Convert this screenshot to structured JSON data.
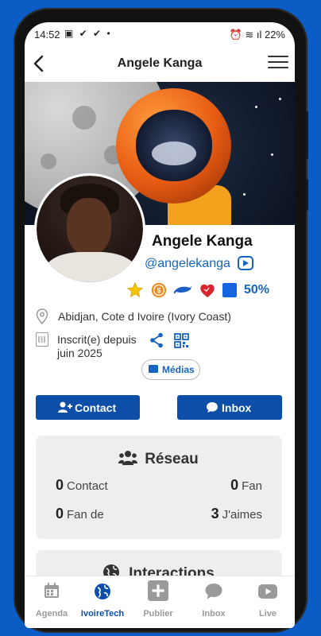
{
  "status_bar": {
    "time": "14:52",
    "left_icons": "▣ ✔ ✔ •",
    "right_text": "⏰ ≋ ıl 22%"
  },
  "header": {
    "title": "Angele Kanga"
  },
  "profile": {
    "name": "Angele Kanga",
    "handle": "@angelekanga",
    "progress_percent": "50%",
    "location": "Abidjan, Cote d Ivoire (Ivory Coast)",
    "joined_line1": "Inscrit(e) depuis",
    "joined_line2": "juin 2025",
    "media_label": "Médias"
  },
  "actions": {
    "contact_label": "Contact",
    "inbox_label": "Inbox"
  },
  "network": {
    "title": "Réseau",
    "stats": [
      {
        "value": "0",
        "label": "Contact"
      },
      {
        "value": "0",
        "label": "Fan"
      },
      {
        "value": "0",
        "label": "Fan de"
      },
      {
        "value": "3",
        "label": "J'aimes"
      }
    ]
  },
  "interactions": {
    "title": "Interactions"
  },
  "bottom_nav": [
    {
      "label": "Agenda",
      "icon": "calendar-icon",
      "active": false
    },
    {
      "label": "IvoireTech",
      "icon": "globe-icon",
      "active": true
    },
    {
      "label": "Publier",
      "icon": "plus-square-icon",
      "active": false
    },
    {
      "label": "Inbox",
      "icon": "chat-icon",
      "active": false
    },
    {
      "label": "Live",
      "icon": "youtube-icon",
      "active": false
    }
  ],
  "colors": {
    "background": "#0b5cc4",
    "primary": "#0d4fa8",
    "link": "#1565c0",
    "card": "#eeeeee",
    "nav_inactive": "#9a9a9a"
  }
}
